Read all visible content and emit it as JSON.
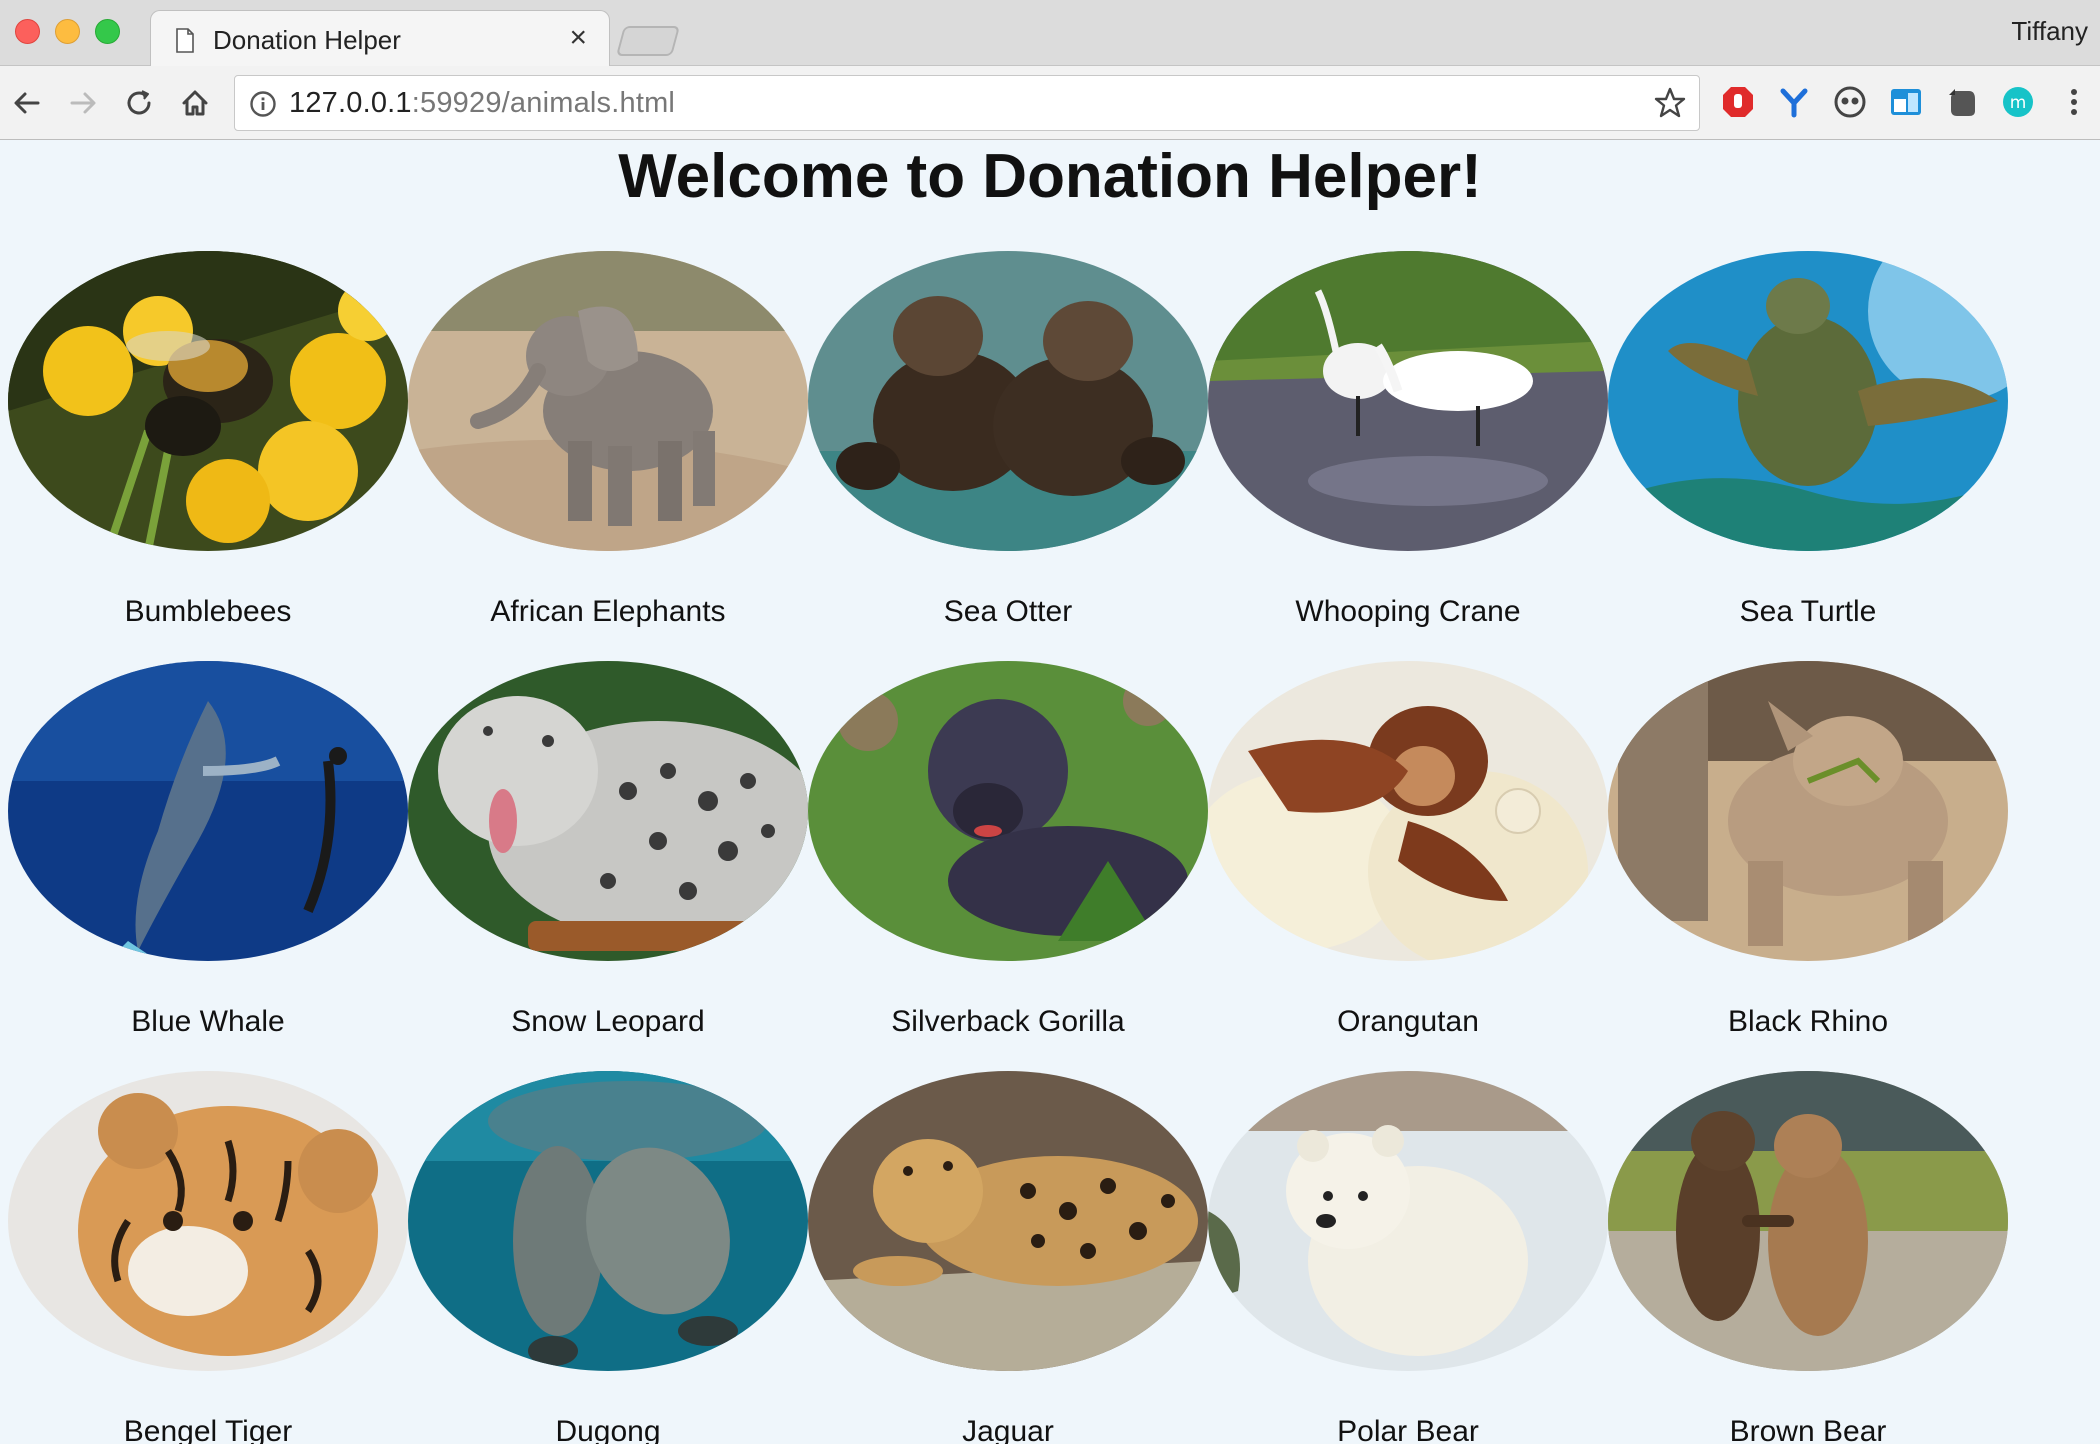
{
  "browser": {
    "tab_title": "Donation Helper",
    "tab_close": "×",
    "profile_name": "Tiffany",
    "url_host": "127.0.0.1",
    "url_rest": ":59929/animals.html"
  },
  "page": {
    "title": "Welcome to Donation Helper!",
    "animals": [
      {
        "name": "Bumblebees"
      },
      {
        "name": "African Elephants"
      },
      {
        "name": "Sea Otter"
      },
      {
        "name": "Whooping Crane"
      },
      {
        "name": "Sea Turtle"
      },
      {
        "name": "Blue Whale"
      },
      {
        "name": "Snow Leopard"
      },
      {
        "name": "Silverback Gorilla"
      },
      {
        "name": "Orangutan"
      },
      {
        "name": "Black Rhino"
      },
      {
        "name": "Bengel Tiger"
      },
      {
        "name": "Dugong"
      },
      {
        "name": "Jaguar"
      },
      {
        "name": "Polar Bear"
      },
      {
        "name": "Brown Bear"
      }
    ]
  },
  "colors": {
    "page_background": "#eff6fb",
    "ext_red": "#e02b2b",
    "ext_blue": "#1e6fd9",
    "ext_teal": "#17c3c8"
  }
}
